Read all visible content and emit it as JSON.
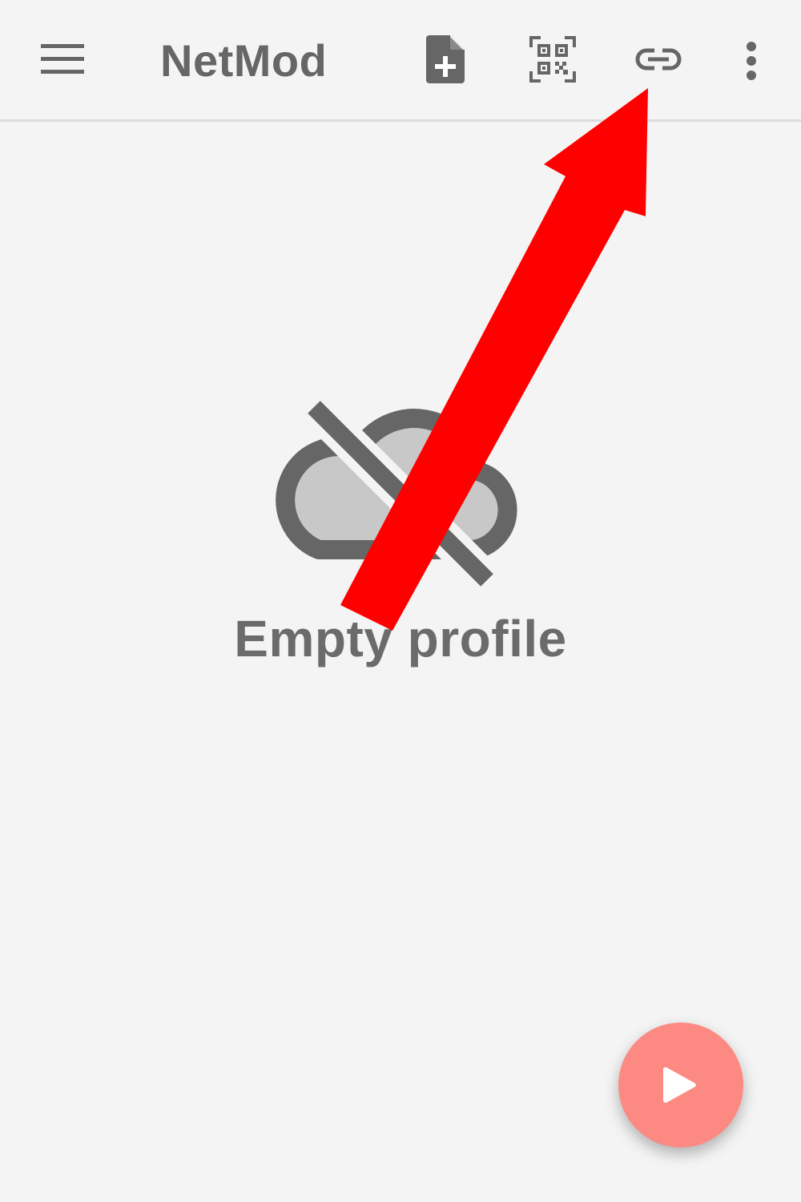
{
  "app_bar": {
    "title": "NetMod",
    "icons": {
      "menu": "menu-icon",
      "add_file": "add-file-icon",
      "qr_scan": "qr-scan-icon",
      "link": "link-icon",
      "more": "more-vert-icon"
    }
  },
  "empty_state": {
    "icon": "cloud-off-icon",
    "label": "Empty profile"
  },
  "fab": {
    "icon": "play-icon"
  },
  "colors": {
    "background": "#f4f4f4",
    "icon_gray": "#666666",
    "fab": "#fc8a82",
    "annotation": "#ff0000"
  }
}
